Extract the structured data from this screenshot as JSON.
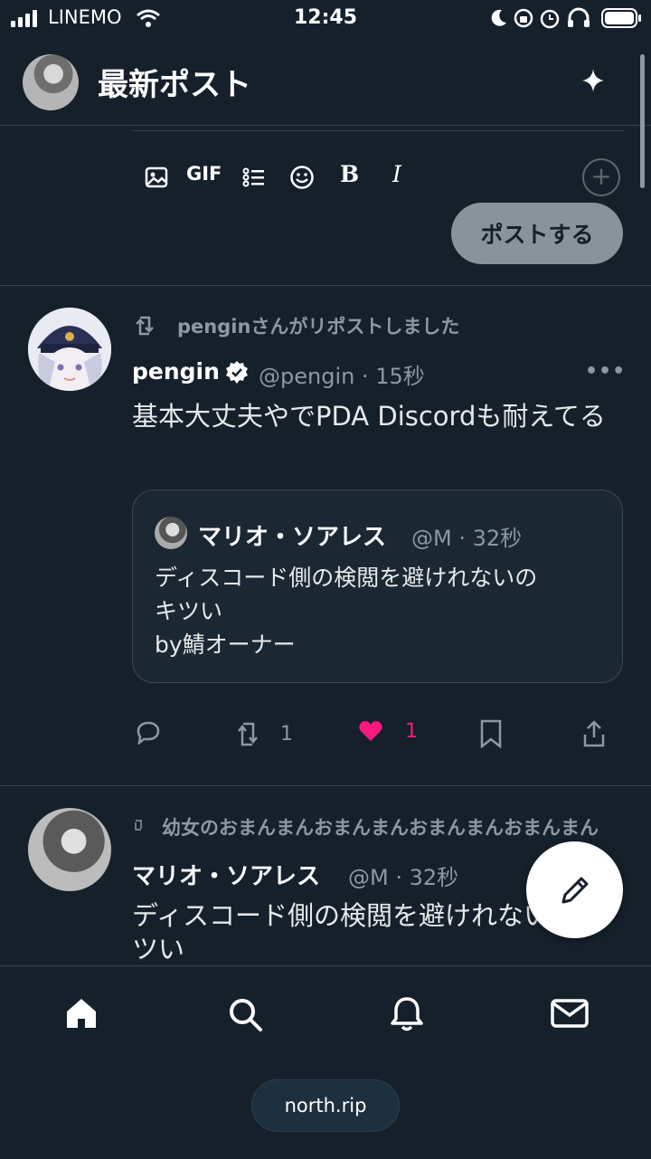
{
  "status_bar": {
    "carrier": "LINEMO",
    "time": "12:45"
  },
  "header": {
    "title": "最新ポスト"
  },
  "composer": {
    "gif_label": "GIF",
    "bold_label": "B",
    "italic_label": "I",
    "post_button_label": "ポストする"
  },
  "timeline": [
    {
      "repost_label": "penginさんがリポストしました",
      "name": "pengin",
      "handle_time": "@pengin · 15秒",
      "body": "基本大丈夫やでPDA Discordも耐えてる",
      "quote": {
        "name": "マリオ・ソアレス",
        "handle_time": "@M · 32秒",
        "body_lines": [
          "ディスコード側の検閲を避けれないの",
          "キツい",
          "by鯖オーナー"
        ]
      },
      "actions": {
        "retweet_count": "1",
        "like_count": "1"
      }
    },
    {
      "repost_label": "幼女のおまんまんおまんまんおまんまんおまんまん",
      "name": "マリオ・ソアレス",
      "handle_time": "@M · 32秒",
      "body": "ディスコード側の検閲を避けれないのキツい"
    }
  ],
  "footer": {
    "url": "north.rip"
  },
  "colors": {
    "background": "#15202b",
    "like": "#f91880",
    "muted": "#8b98a5"
  }
}
